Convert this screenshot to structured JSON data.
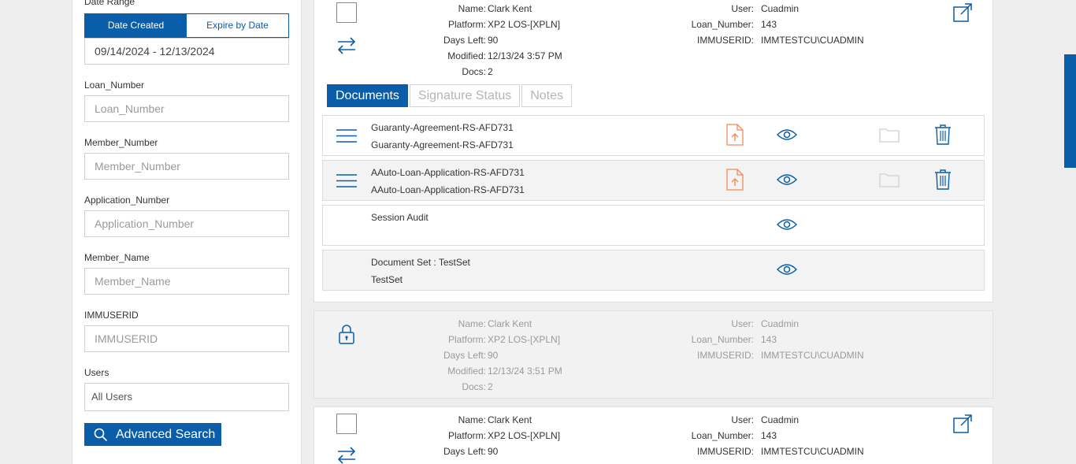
{
  "filters": {
    "date_range_label": "Date Range",
    "date_toggle": {
      "created": "Date Created",
      "expire": "Expire by Date"
    },
    "date_value": "09/14/2024 - 12/13/2024",
    "loan_number": {
      "label": "Loan_Number",
      "placeholder": "Loan_Number"
    },
    "member_number": {
      "label": "Member_Number",
      "placeholder": "Member_Number"
    },
    "application_number": {
      "label": "Application_Number",
      "placeholder": "Application_Number"
    },
    "member_name": {
      "label": "Member_Name",
      "placeholder": "Member_Name"
    },
    "immuserid": {
      "label": "IMMUSERID",
      "placeholder": "IMMUSERID"
    },
    "users": {
      "label": "Users",
      "value": "All Users"
    },
    "advanced_search": "Advanced Search"
  },
  "meta_keys": {
    "name": "Name:",
    "platform": "Platform:",
    "days_left": "Days Left:",
    "modified": "Modified:",
    "docs": "Docs:",
    "user": "User:",
    "loan_number": "Loan_Number:",
    "immuserid": "IMMUSERID:"
  },
  "cards": [
    {
      "name": "Clark Kent",
      "platform": "XP2 LOS-[XPLN]",
      "days_left": "90",
      "modified": "12/13/24 3:57 PM",
      "docs": "2",
      "user": "Cuadmin",
      "loan_number": "143",
      "immuserid": "IMMTESTCU\\CUADMIN",
      "tabs": [
        "Documents",
        "Signature Status",
        "Notes"
      ],
      "documents": [
        {
          "title": "Guaranty-Agreement-RS-AFD731",
          "subtitle": "Guaranty-Agreement-RS-AFD731"
        },
        {
          "title": "AAuto-Loan-Application-RS-AFD731",
          "subtitle": "AAuto-Loan-Application-RS-AFD731"
        },
        {
          "title": "Session Audit",
          "subtitle": ""
        },
        {
          "title": "Document Set : TestSet",
          "subtitle": "TestSet"
        }
      ]
    },
    {
      "name": "Clark Kent",
      "platform": "XP2 LOS-[XPLN]",
      "days_left": "90",
      "modified": "12/13/24 3:51 PM",
      "docs": "2",
      "user": "Cuadmin",
      "loan_number": "143",
      "immuserid": "IMMTESTCU\\CUADMIN"
    },
    {
      "name": "Clark Kent",
      "platform": "XP2 LOS-[XPLN]",
      "days_left": "90",
      "user": "Cuadmin",
      "loan_number": "143",
      "immuserid": "IMMTESTCU\\CUADMIN"
    }
  ],
  "colors": {
    "primary": "#0a5da8",
    "upload_accent": "#f08a5d"
  }
}
